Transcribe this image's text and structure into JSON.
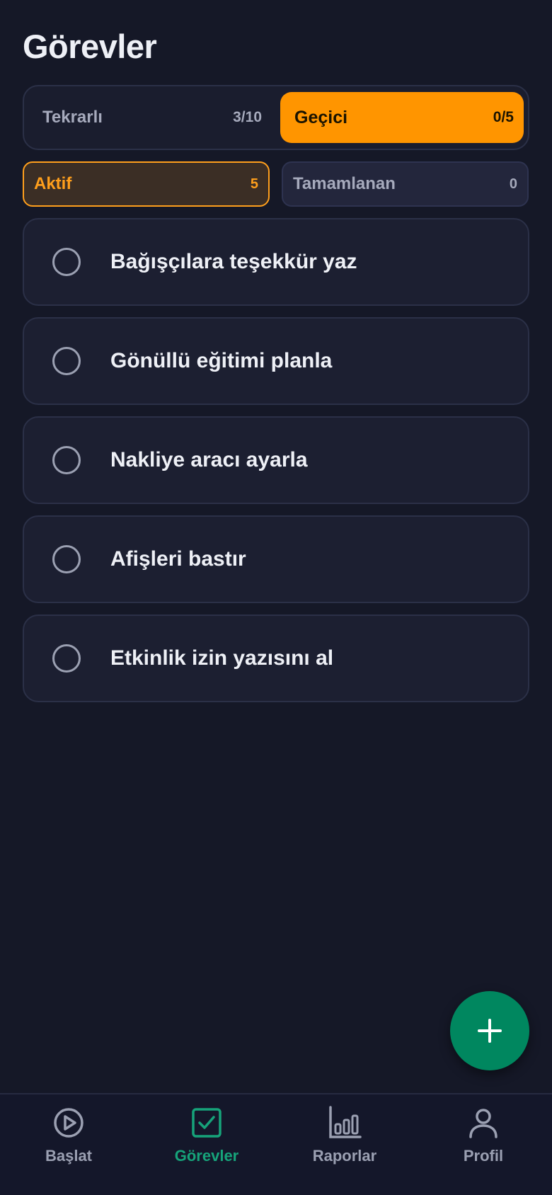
{
  "page": {
    "title": "Görevler"
  },
  "segment": {
    "left": {
      "label": "Tekrarlı",
      "count": "3/10"
    },
    "right": {
      "label": "Geçici",
      "count": "0/5"
    }
  },
  "filters": {
    "active": {
      "label": "Aktif",
      "count": "5"
    },
    "completed": {
      "label": "Tamamlanan",
      "count": "0"
    }
  },
  "tasks": [
    {
      "title": "Bağışçılara teşekkür yaz"
    },
    {
      "title": "Gönüllü eğitimi planla"
    },
    {
      "title": "Nakliye aracı ayarla"
    },
    {
      "title": "Afişleri bastır"
    },
    {
      "title": "Etkinlik izin yazısını al"
    }
  ],
  "fab": {
    "icon": "plus-icon"
  },
  "nav": {
    "items": [
      {
        "label": "Başlat",
        "icon": "play-circle-icon"
      },
      {
        "label": "Görevler",
        "icon": "checkbox-icon"
      },
      {
        "label": "Raporlar",
        "icon": "bar-chart-icon"
      },
      {
        "label": "Profil",
        "icon": "user-icon"
      }
    ]
  },
  "colors": {
    "background": "#151827",
    "accent_orange": "#ff9500",
    "accent_green": "#00875f",
    "nav_active": "#16a37a"
  }
}
